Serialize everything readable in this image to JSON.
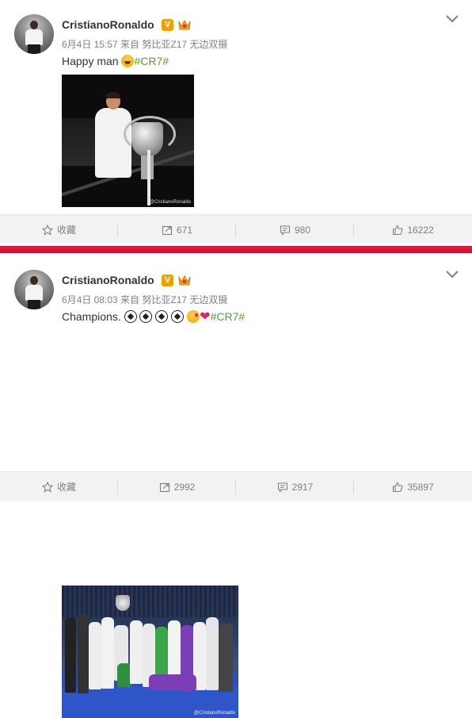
{
  "posts": [
    {
      "username": "CristianoRonaldo",
      "verified_badge": "V",
      "meta": "6月4日 15:57 来自 努比亚Z17 无边双摄",
      "text": "Happy man ",
      "hashtag": "#CR7#",
      "photo_watermark": "@CristianoRonaldo",
      "actions": {
        "favorite": "收藏",
        "reposts": "671",
        "comments": "980",
        "likes": "16222"
      }
    },
    {
      "username": "CristianoRonaldo",
      "verified_badge": "V",
      "meta": "6月4日 08:03 来自 努比亚Z17 无边双摄",
      "text": "Champions. ",
      "hashtag": "#CR7#",
      "photo_watermark": "@CristianoRonaldo",
      "actions": {
        "favorite": "收藏",
        "reposts": "2992",
        "comments": "2917",
        "likes": "35897"
      }
    }
  ],
  "colors": {
    "divider": "#d7173a",
    "hashtag": "#5c9b2c",
    "verified": "#f0a000",
    "action_bar": "#f2f2f5"
  },
  "icons": [
    "star-icon",
    "repost-icon",
    "comment-icon",
    "like-icon",
    "chevron-down-icon",
    "vip-icon"
  ]
}
